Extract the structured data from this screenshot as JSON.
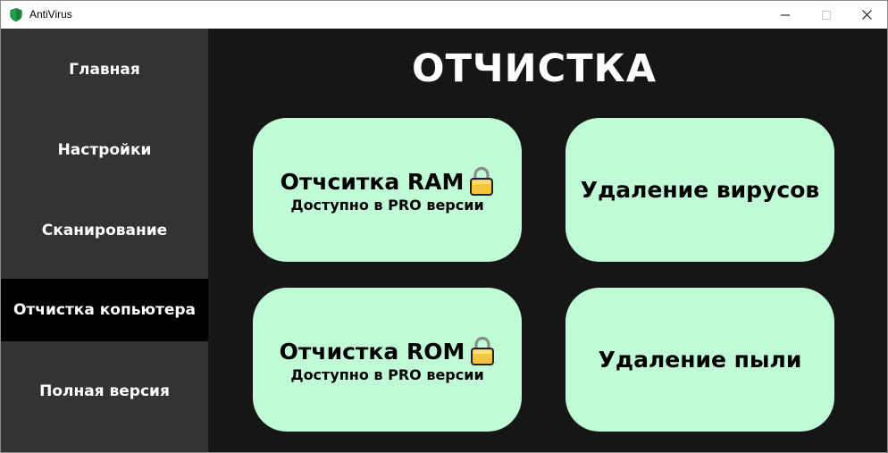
{
  "window": {
    "title": "AntiVirus",
    "icons": {
      "app": "shield-icon",
      "minimize": "minimize-icon",
      "maximize": "maximize-icon",
      "close": "close-icon"
    }
  },
  "sidebar": {
    "items": [
      {
        "label": "Главная",
        "active": false
      },
      {
        "label": "Настройки",
        "active": false
      },
      {
        "label": "Сканирование",
        "active": false
      },
      {
        "label": "Отчистка копьютера",
        "active": true
      },
      {
        "label": "Полная версия",
        "active": false
      }
    ]
  },
  "main": {
    "title": "ОТЧИСТКА",
    "cards": [
      {
        "title": "Отчситка RAM",
        "subtitle": "Доступно в PRO версии",
        "locked": true,
        "icon": "lock-icon"
      },
      {
        "title": "Удаление вирусов",
        "subtitle": "",
        "locked": false
      },
      {
        "title": "Отчистка ROM",
        "subtitle": "Доступно в PRO версии",
        "locked": true,
        "icon": "lock-icon"
      },
      {
        "title": "Удаление пыли",
        "subtitle": "",
        "locked": false
      }
    ]
  },
  "colors": {
    "sidebar_bg": "#333333",
    "sidebar_active_bg": "#000000",
    "main_bg": "#161616",
    "card_bg": "#c0fad6",
    "shield_green": "#1fa34a",
    "lock_gold": "#f5c542"
  }
}
